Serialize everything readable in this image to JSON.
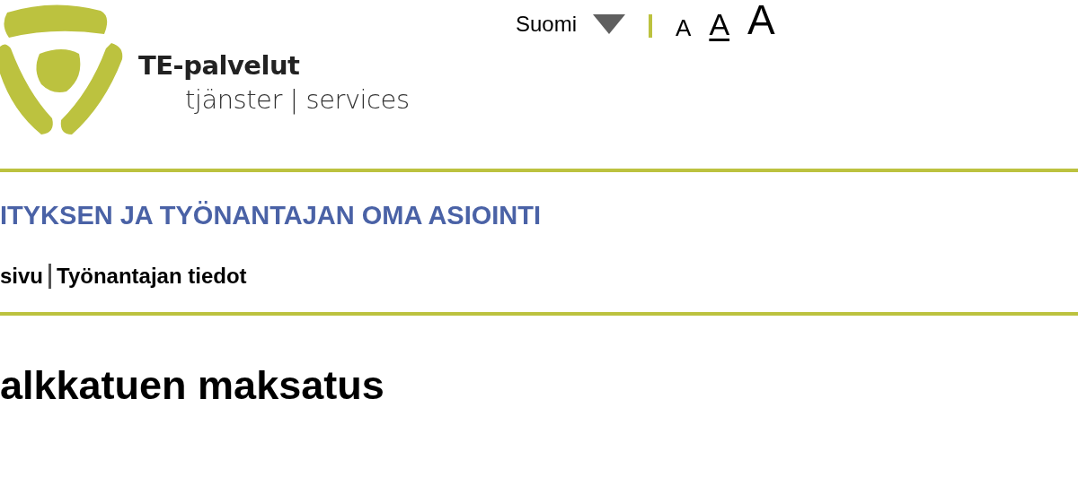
{
  "logo": {
    "name": "TE-palvelut",
    "tagline": "tjänster | services"
  },
  "language": {
    "label": "Suomi"
  },
  "font_sizes": [
    {
      "label": "A",
      "kind": "small",
      "selected": false
    },
    {
      "label": "A",
      "kind": "medium",
      "selected": true
    },
    {
      "label": "A",
      "kind": "large",
      "selected": false
    }
  ],
  "service_title": "ITYKSEN JA TYÖNANTAJAN OMA ASIOINTI",
  "breadcrumb": [
    {
      "label": "sivu"
    },
    {
      "label": "Työnantajan tiedot"
    }
  ],
  "page_title": "alkkatuen maksatus"
}
